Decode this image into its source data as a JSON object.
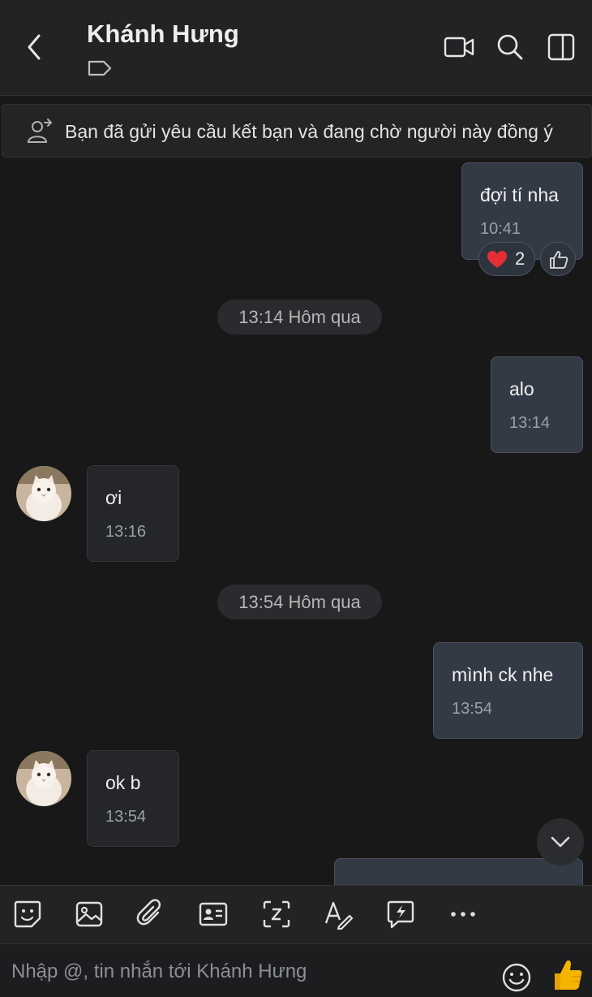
{
  "header": {
    "title": "Khánh Hưng",
    "icons": [
      "back-arrow-icon",
      "tag-icon",
      "video-call-icon",
      "search-icon",
      "side-panel-icon"
    ]
  },
  "banner": {
    "text": "Bạn đã gửi yêu cầu kết bạn và đang chờ người này đồng ý"
  },
  "messages": [
    {
      "direction": "outgoing",
      "text": "đợi tí nha",
      "time": "10:41",
      "reactions": {
        "heart_count": "2"
      }
    },
    {
      "type": "date",
      "label": "13:14 Hôm qua"
    },
    {
      "direction": "outgoing",
      "text": "alo",
      "time": "13:14"
    },
    {
      "direction": "incoming",
      "text": "ơi",
      "time": "13:16"
    },
    {
      "type": "date",
      "label": "13:54 Hôm qua"
    },
    {
      "direction": "outgoing",
      "text": "mình ck nhe",
      "time": "13:54"
    },
    {
      "direction": "incoming",
      "text": "ok b",
      "time": "13:54"
    }
  ],
  "toolbar": {
    "items": [
      "sticker-icon",
      "image-icon",
      "attachment-icon",
      "contact-card-icon",
      "screenshot-icon",
      "text-format-icon",
      "quick-message-icon",
      "more-icon"
    ]
  },
  "composer": {
    "placeholder": "Nhập @, tin nhắn tới Khánh Hưng"
  },
  "colors": {
    "background": "#181818",
    "header": "#222325",
    "outgoing_bubble": "#333a46",
    "incoming_bubble": "#25262a",
    "like_button": "#f5b400"
  }
}
